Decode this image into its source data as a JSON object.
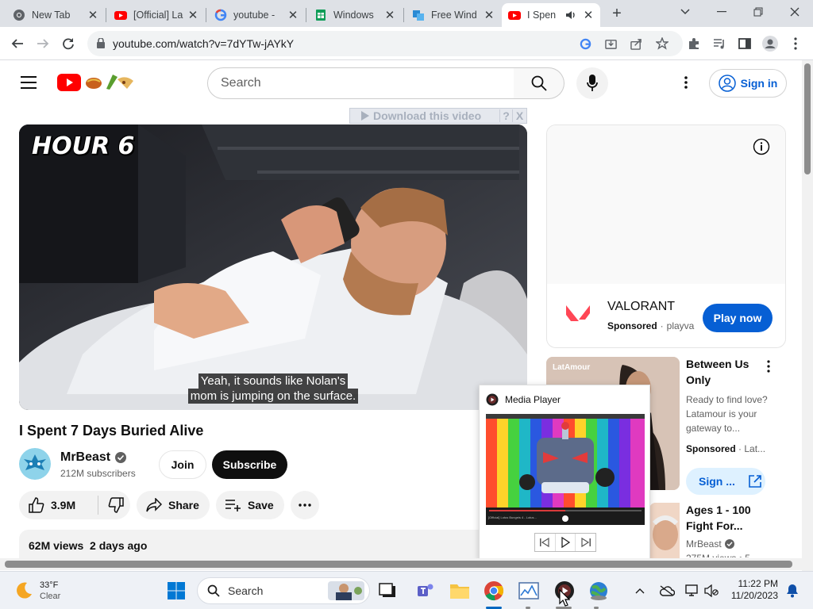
{
  "browser": {
    "tabs": [
      {
        "label": "New Tab",
        "icon": "chrome-icon"
      },
      {
        "label": "[Official] La",
        "icon": "youtube-icon"
      },
      {
        "label": "youtube -",
        "icon": "google-icon"
      },
      {
        "label": "Windows",
        "icon": "sheets-icon"
      },
      {
        "label": "Free Wind",
        "icon": "edge-icon"
      },
      {
        "label": "I Spen",
        "icon": "youtube-icon"
      }
    ],
    "url": "youtube.com/watch?v=7dYTw-jAYkY"
  },
  "youtube": {
    "search_placeholder": "Search",
    "sign_in": "Sign in",
    "download_bar": "Download this video",
    "download_help": "?",
    "download_close": "X"
  },
  "video": {
    "overlay_text": "HOUR 6",
    "caption_line1": "Yeah, it sounds like Nolan's",
    "caption_line2": "mom is jumping on the surface.",
    "title": "I Spent 7 Days Buried Alive",
    "channel": "MrBeast",
    "subscribers": "212M subscribers",
    "join": "Join",
    "subscribe": "Subscribe",
    "likes": "3.9M",
    "share": "Share",
    "save": "Save",
    "views": "62M views",
    "age": "2 days ago"
  },
  "ad": {
    "brand": "VALORANT",
    "sponsored": "Sponsored",
    "advertiser": "playva",
    "cta": "Play now"
  },
  "related": [
    {
      "thumb_label": "LatAmour",
      "title_line1": "Between Us",
      "title_line2": "Only",
      "desc1": "Ready to find love?",
      "desc2": "Latamour is your",
      "desc3": "gateway to...",
      "meta": "Sponsored",
      "meta2": "Lat...",
      "cta": "Sign ..."
    },
    {
      "title_line1": "Ages 1 - 100",
      "title_line2": "Fight For...",
      "channel": "MrBeast",
      "meta": "275M views • 5"
    }
  ],
  "media_player": {
    "title": "Media Player",
    "progress_text": "[Official] Lotus Bungeis 4 - Lotus..."
  },
  "taskbar": {
    "weather_temp": "33°F",
    "weather_desc": "Clear",
    "search": "Search",
    "time": "11:22 PM",
    "date": "11/20/2023"
  },
  "colors": {
    "yt_red": "#ff0000",
    "link_blue": "#065fd4",
    "valorant_red": "#ff4655",
    "cta_blue": "#065fd4"
  }
}
